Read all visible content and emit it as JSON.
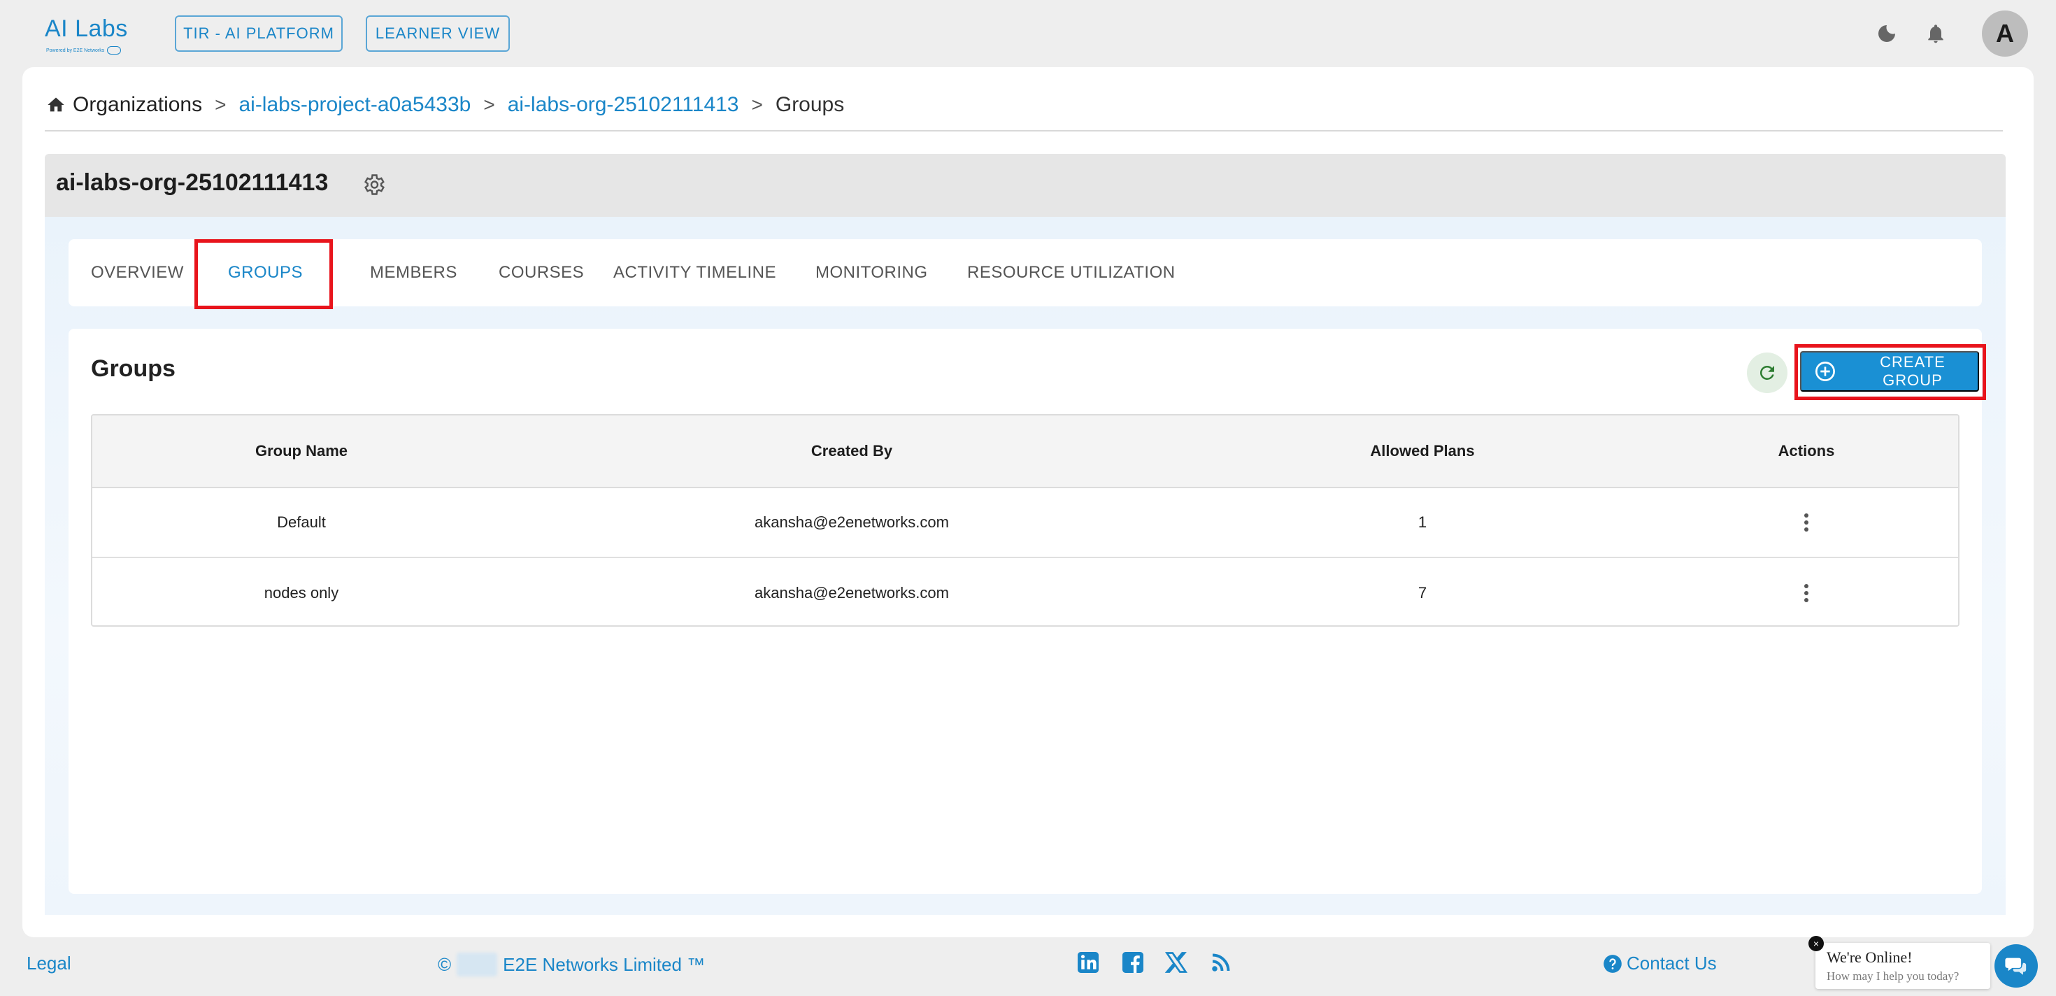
{
  "header": {
    "logo_text": "AI Labs",
    "logo_subtext": "Powered by E2E Networks",
    "tir_button": "TIR - AI PLATFORM",
    "learner_button": "LEARNER VIEW",
    "avatar_letter": "A"
  },
  "breadcrumb": {
    "home": "Organizations",
    "project": "ai-labs-project-a0a5433b",
    "org": "ai-labs-org-25102111413",
    "current": "Groups",
    "separator": ">"
  },
  "org": {
    "title": "ai-labs-org-25102111413"
  },
  "tabs": [
    {
      "label": "OVERVIEW",
      "active": false
    },
    {
      "label": "GROUPS",
      "active": true
    },
    {
      "label": "MEMBERS",
      "active": false
    },
    {
      "label": "COURSES",
      "active": false
    },
    {
      "label": "ACTIVITY TIMELINE",
      "active": false
    },
    {
      "label": "MONITORING",
      "active": false
    },
    {
      "label": "RESOURCE UTILIZATION",
      "active": false
    }
  ],
  "groups": {
    "title": "Groups",
    "create_button": "CREATE GROUP",
    "columns": [
      "Group Name",
      "Created By",
      "Allowed Plans",
      "Actions"
    ],
    "rows": [
      {
        "name": "Default",
        "created_by": "akansha@e2enetworks.com",
        "allowed_plans": "1"
      },
      {
        "name": "nodes only",
        "created_by": "akansha@e2enetworks.com",
        "allowed_plans": "7"
      }
    ]
  },
  "footer": {
    "legal": "Legal",
    "copyright_symbol": "©",
    "company": "E2E Networks Limited ™",
    "contact": "Contact Us"
  },
  "chat": {
    "title": "We're Online!",
    "subtitle": "How may I help you today?",
    "close": "×"
  },
  "colors": {
    "accent": "#1a86c8",
    "highlight": "#e8141c",
    "button": "#1a90d4"
  }
}
